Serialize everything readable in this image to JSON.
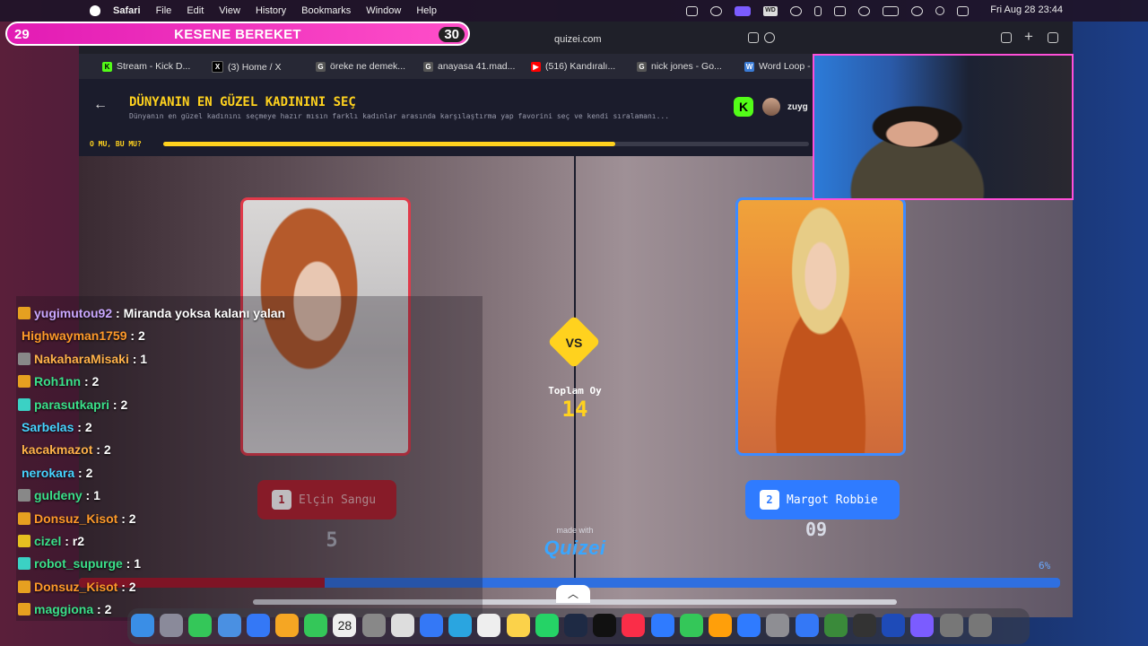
{
  "menubar": {
    "app": "Safari",
    "items": [
      "File",
      "Edit",
      "View",
      "History",
      "Bookmarks",
      "Window",
      "Help"
    ],
    "clock": "Fri Aug 28  23:44"
  },
  "timer": {
    "left": "29",
    "title": "KESENE BEREKET",
    "right": "30"
  },
  "browser": {
    "url": "quizei.com",
    "tabs": [
      {
        "label": "Stream - Kick D...",
        "icon": "K",
        "color": "#53fc18"
      },
      {
        "label": "(3) Home / X",
        "icon": "X",
        "color": "#000000"
      },
      {
        "label": "öreke ne demek...",
        "icon": "G",
        "color": "#555555"
      },
      {
        "label": "anayasa 41.mad...",
        "icon": "G",
        "color": "#555555"
      },
      {
        "label": "(516) Kandıralı...",
        "icon": "▶",
        "color": "#ff0000"
      },
      {
        "label": "nick jones - Go...",
        "icon": "G",
        "color": "#555555"
      },
      {
        "label": "Word Loop - F",
        "icon": "W",
        "color": "#3a7bd5"
      }
    ]
  },
  "quiz": {
    "title": "DÜNYANIN EN GÜZEL KADININI SEÇ",
    "description": "Dünyanın en güzel kadınını seçmeye hazır mısın farklı kadınlar arasında karşılaştırma yap favorini seç ve kendi sıralamanı...",
    "round_label": "O MU, BU MU?",
    "progress": 0.7,
    "username": "zuyg",
    "left": {
      "num": "1",
      "name": "Elçin Sangu",
      "score": "5"
    },
    "right": {
      "num": "2",
      "name": "Margot Robbie",
      "score": "09"
    },
    "vs": "VS",
    "total_label": "Toplam Oy",
    "total": "14",
    "made_with": "made with",
    "brand": "Quizei",
    "percent": "6%",
    "vote_share_left": 0.35
  },
  "chat": [
    {
      "user": "yugimutou92",
      "msg": "Miranda yoksa kalanı yalan",
      "color": "#c9a8ff",
      "badge": "#e6a020"
    },
    {
      "user": "Highwayman1759",
      "msg": "2",
      "color": "#ff9a2a",
      "badge": ""
    },
    {
      "user": "NakaharaMisaki",
      "msg": "1",
      "color": "#ffb24a",
      "badge": "#888888"
    },
    {
      "user": "Roh1nn",
      "msg": "2",
      "color": "#3be08a",
      "badge": "#e6a020"
    },
    {
      "user": "parasutkapri",
      "msg": "2",
      "color": "#3be08a",
      "badge": "#3bd1c4"
    },
    {
      "user": "Sarbelas",
      "msg": "2",
      "color": "#46d4ff",
      "badge": ""
    },
    {
      "user": "kacakmazot",
      "msg": "2",
      "color": "#ffb24a",
      "badge": ""
    },
    {
      "user": "nerokara",
      "msg": "2",
      "color": "#46d4ff",
      "badge": ""
    },
    {
      "user": "guldeny",
      "msg": "1",
      "color": "#3be08a",
      "badge": "#888888"
    },
    {
      "user": "Donsuz_Kisot",
      "msg": "2",
      "color": "#ff9a2a",
      "badge": "#e6a020"
    },
    {
      "user": "cizel",
      "msg": "r2",
      "color": "#3be08a",
      "badge": "#e6c020"
    },
    {
      "user": "robot_supurge",
      "msg": "1",
      "color": "#3be08a",
      "badge": "#3bd1c4"
    },
    {
      "user": "Donsuz_Kisot",
      "msg": "2",
      "color": "#ff9a2a",
      "badge": "#e6a020"
    },
    {
      "user": "maggiona",
      "msg": "2",
      "color": "#3be08a",
      "badge": "#e6a020"
    }
  ],
  "dock": {
    "date": "28"
  }
}
